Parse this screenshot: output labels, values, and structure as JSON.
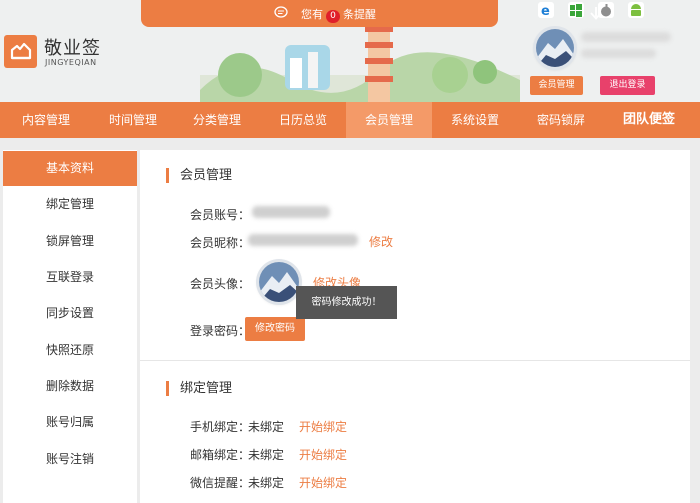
{
  "header": {
    "notice_prefix": "您有",
    "notice_count": "0",
    "notice_suffix": "条提醒",
    "brand_name": "敬业签",
    "brand_pinyin": "JINGYEQIAN",
    "member_button": "会员管理",
    "logout_button": "退出登录",
    "platforms": [
      "ie-icon",
      "windows-icon",
      "apple-icon",
      "android-icon"
    ]
  },
  "nav": {
    "items": [
      "内容管理",
      "时间管理",
      "分类管理",
      "日历总览",
      "会员管理",
      "系统设置",
      "密码锁屏",
      "团队便签"
    ],
    "active_index": 4
  },
  "sidebar": {
    "items": [
      "基本资料",
      "绑定管理",
      "锁屏管理",
      "互联登录",
      "同步设置",
      "快照还原",
      "删除数据",
      "账号归属",
      "账号注销"
    ],
    "active_index": 0
  },
  "profile": {
    "title": "会员管理",
    "account_label": "会员账号：",
    "nickname_label": "会员昵称：",
    "nickname_edit": "修改",
    "avatar_label": "会员头像：",
    "avatar_edit": "修改头像",
    "password_label": "登录密码：",
    "password_button": "修改密码"
  },
  "binding": {
    "title": "绑定管理",
    "rows": [
      {
        "label": "手机绑定：",
        "status": "未绑定",
        "action": "开始绑定"
      },
      {
        "label": "邮箱绑定：",
        "status": "未绑定",
        "action": "开始绑定"
      },
      {
        "label": "微信提醒：",
        "status": "未绑定",
        "action": "开始绑定"
      }
    ]
  },
  "toast": "密码修改成功！",
  "colors": {
    "accent": "#ec7d43",
    "nav_active": "#f49a68",
    "logout": "#e8416b"
  }
}
